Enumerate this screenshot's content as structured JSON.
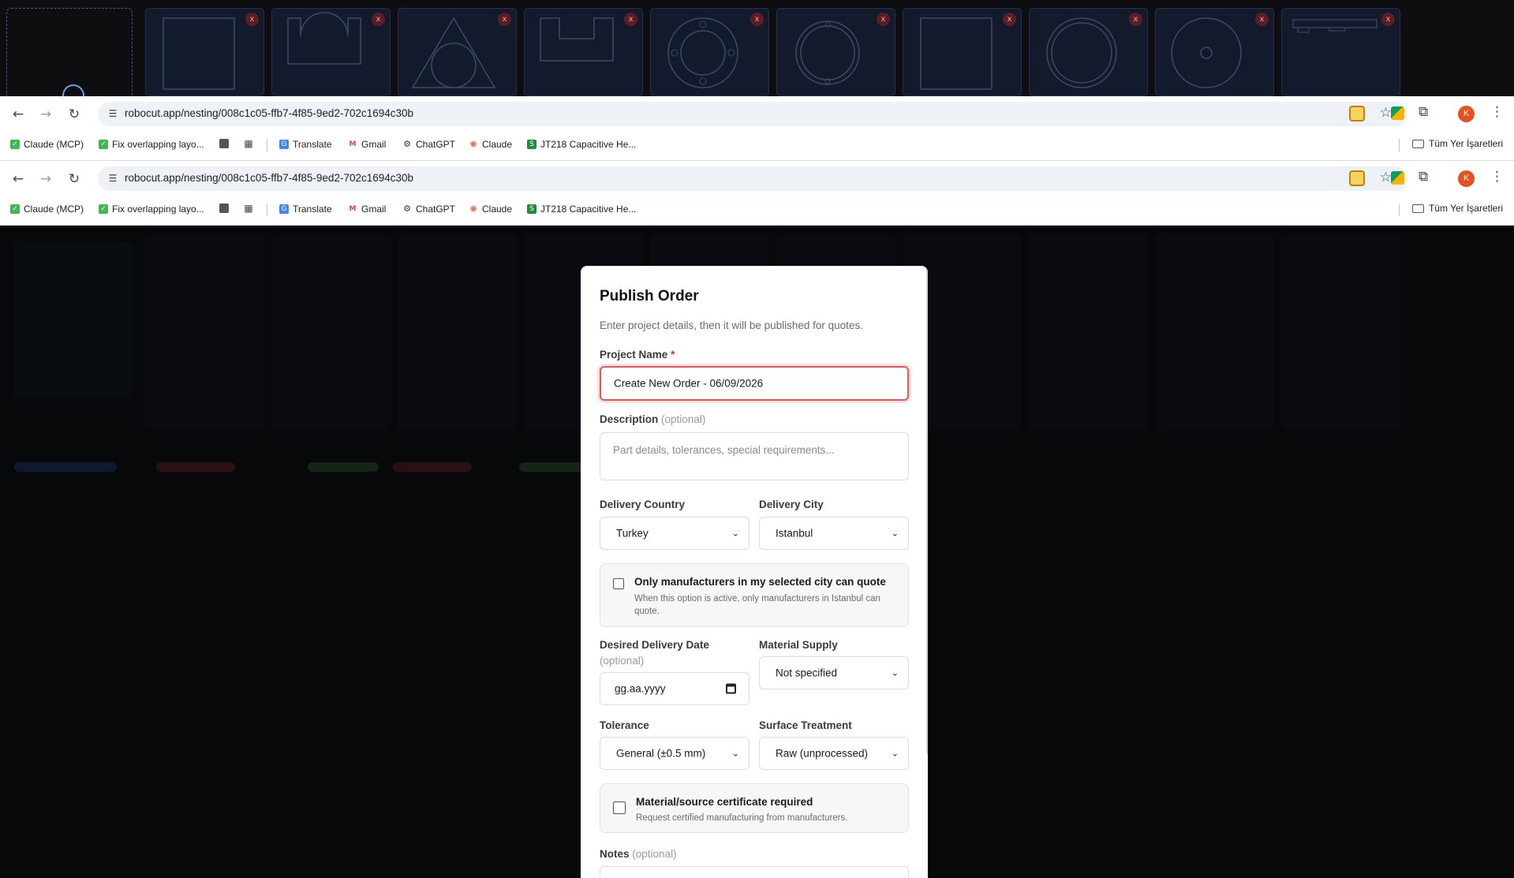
{
  "browser": {
    "url": "robocut.app/nesting/008c1c05-ffb7-4f85-9ed2-702c1694c30b",
    "profile_initial": "K",
    "bookmarks": [
      {
        "label": "Claude (MCP)"
      },
      {
        "label": "Fix overlapping layo..."
      },
      {
        "label": ""
      },
      {
        "label": ""
      },
      {
        "label": "Translate"
      },
      {
        "label": "Gmail"
      },
      {
        "label": "ChatGPT"
      },
      {
        "label": "Claude"
      },
      {
        "label": "JT218 Capacitive He..."
      }
    ],
    "bookmarks_folder": "Tüm Yer İşaretleri"
  },
  "thumbnails": {
    "remove_label": "x",
    "count": 10
  },
  "modal": {
    "title": "Publish Order",
    "subtitle": "Enter project details, then it will be published for quotes.",
    "project_name": {
      "label": "Project Name",
      "required_mark": "*",
      "value": "Create New Order - 06/09/2026"
    },
    "description": {
      "label": "Description",
      "optional": "(optional)",
      "placeholder": "Part details, tolerances, special requirements..."
    },
    "delivery_country": {
      "label": "Delivery Country",
      "value": "Turkey"
    },
    "delivery_city": {
      "label": "Delivery City",
      "value": "Istanbul"
    },
    "city_only": {
      "title": "Only manufacturers in my selected city can quote",
      "desc": "When this option is active, only manufacturers in Istanbul can quote."
    },
    "delivery_date": {
      "label": "Desired Delivery Date",
      "optional": "(optional)",
      "placeholder": "gg.aa.yyyy"
    },
    "material_supply": {
      "label": "Material Supply",
      "value": "Not specified"
    },
    "tolerance": {
      "label": "Tolerance",
      "value": "General (±0.5 mm)"
    },
    "surface_treatment": {
      "label": "Surface Treatment",
      "value": "Raw (unprocessed)"
    },
    "certificate": {
      "title": "Material/source certificate required",
      "desc": "Request certified manufacturing from manufacturers."
    },
    "notes": {
      "label": "Notes",
      "optional": "(optional)"
    }
  },
  "colors": {
    "accent_red": "#e05a5a",
    "thumb_bg": "#131a2c",
    "remove_badge": "#5a1e24"
  }
}
